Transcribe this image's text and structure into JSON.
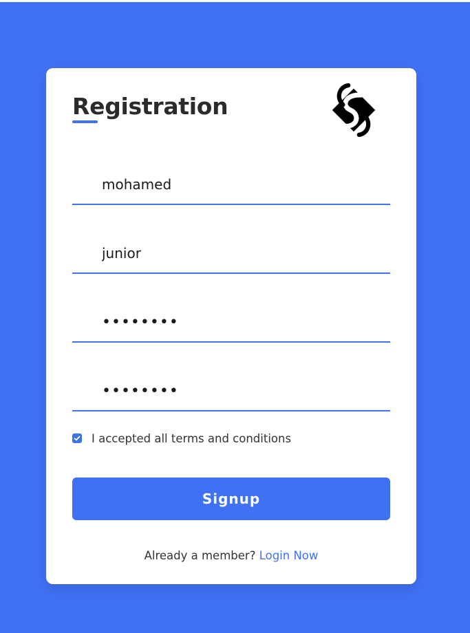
{
  "form": {
    "title": "Registration",
    "fields": [
      {
        "value": "mohamed",
        "type": "text"
      },
      {
        "value": "junior",
        "type": "text"
      },
      {
        "value": "••••••••",
        "type": "password"
      },
      {
        "value": "••••••••",
        "type": "password"
      }
    ],
    "terms": {
      "checked": true,
      "label": "I accepted all terms and conditions"
    },
    "signup_label": "Signup",
    "login_prompt": "Already a member?",
    "login_link": "Login Now"
  },
  "colors": {
    "accent": "#4070f4",
    "background": "#4070f4",
    "card": "#ffffff",
    "text": "#333333"
  },
  "icons": {
    "logo": "s-logo-icon",
    "checkbox": "check-icon"
  }
}
